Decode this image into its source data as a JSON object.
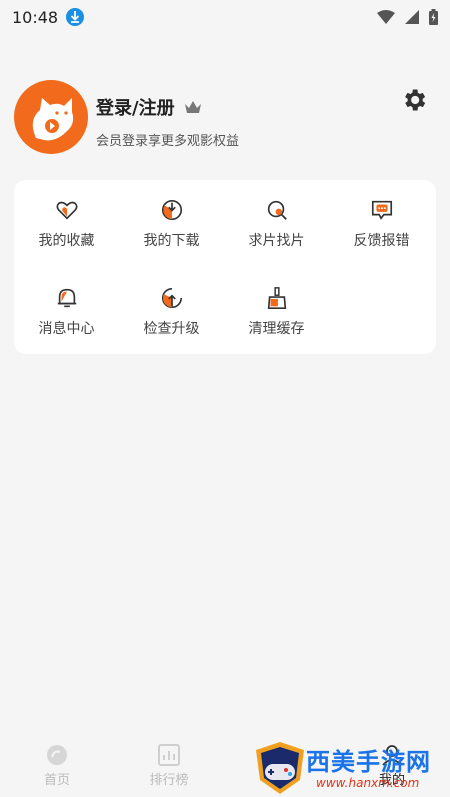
{
  "status_bar": {
    "time": "10:48"
  },
  "profile": {
    "title": "登录/注册",
    "subtitle": "会员登录享更多观影权益"
  },
  "menu": {
    "items": [
      {
        "label": "我的收藏",
        "icon": "heart-icon"
      },
      {
        "label": "我的下载",
        "icon": "download-icon"
      },
      {
        "label": "求片找片",
        "icon": "search-film-icon"
      },
      {
        "label": "反馈报错",
        "icon": "feedback-icon"
      },
      {
        "label": "消息中心",
        "icon": "bell-icon"
      },
      {
        "label": "检查升级",
        "icon": "upgrade-icon"
      },
      {
        "label": "清理缓存",
        "icon": "broom-icon"
      }
    ]
  },
  "tabbar": {
    "tabs": [
      {
        "label": "首页",
        "icon": "home-icon"
      },
      {
        "label": "排行榜",
        "icon": "ranking-icon"
      },
      {
        "label": "我的",
        "icon": "profile-icon"
      }
    ]
  },
  "watermark": {
    "title": "西美手游网",
    "url": "www.hanxm.com"
  },
  "colors": {
    "accent": "#f26a1b",
    "background": "#f5f5f5",
    "card": "#ffffff"
  }
}
